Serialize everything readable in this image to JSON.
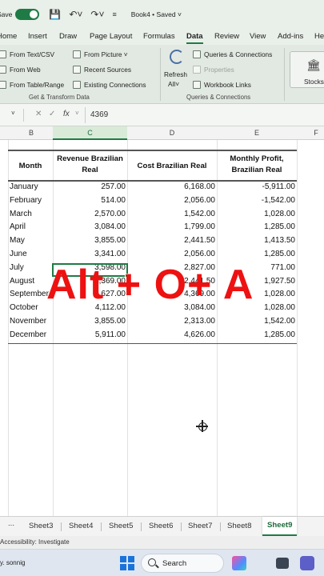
{
  "titlebar": {
    "save_label": "Save",
    "doc_title": "Book4 • Saved"
  },
  "tabs": [
    "Home",
    "Insert",
    "Draw",
    "Page Layout",
    "Formulas",
    "Data",
    "Review",
    "View",
    "Add-ins",
    "He"
  ],
  "active_tab": "Data",
  "ribbon": {
    "from_text_csv": "From Text/CSV",
    "from_web": "From Web",
    "from_table_range": "From Table/Range",
    "from_picture": "From Picture",
    "recent_sources": "Recent Sources",
    "existing_connections": "Existing Connections",
    "group_get_transform": "Get & Transform Data",
    "refresh_all_1": "Refresh",
    "refresh_all_2": "All",
    "queries_connections": "Queries & Connections",
    "properties": "Properties",
    "workbook_links": "Workbook Links",
    "group_queries": "Queries & Connections",
    "stocks": "Stocks"
  },
  "formula_bar": {
    "value": "4369"
  },
  "columns": [
    "B",
    "C",
    "D",
    "E",
    "F"
  ],
  "selected_column": "C",
  "table": {
    "headers": {
      "month": "Month",
      "revenue_1": "Revenue Brazilian",
      "revenue_2": "Real",
      "cost": "Cost Brazilian Real",
      "profit_1": "Monthly Profit,",
      "profit_2": "Brazilian Real"
    },
    "rows": [
      {
        "month": "January",
        "revenue": "257.00",
        "cost": "6,168.00",
        "profit": "-5,911.00"
      },
      {
        "month": "February",
        "revenue": "514.00",
        "cost": "2,056.00",
        "profit": "-1,542.00"
      },
      {
        "month": "March",
        "revenue": "2,570.00",
        "cost": "1,542.00",
        "profit": "1,028.00"
      },
      {
        "month": "April",
        "revenue": "3,084.00",
        "cost": "1,799.00",
        "profit": "1,285.00"
      },
      {
        "month": "May",
        "revenue": "3,855.00",
        "cost": "2,441.50",
        "profit": "1,413.50"
      },
      {
        "month": "June",
        "revenue": "3,341.00",
        "cost": "2,056.00",
        "profit": "1,285.00"
      },
      {
        "month": "July",
        "revenue": "3,598.00",
        "cost": "2,827.00",
        "profit": "771.00"
      },
      {
        "month": "August",
        "revenue": "4,369.00",
        "cost": "2,441.50",
        "profit": "1,927.50"
      },
      {
        "month": "September",
        "revenue": "4,627.00",
        "cost": "4,369.00",
        "profit": "1,028.00"
      },
      {
        "month": "October",
        "revenue": "4,112.00",
        "cost": "3,084.00",
        "profit": "1,028.00"
      },
      {
        "month": "November",
        "revenue": "3,855.00",
        "cost": "2,313.00",
        "profit": "1,542.00"
      },
      {
        "month": "December",
        "revenue": "5,911.00",
        "cost": "4,626.00",
        "profit": "1,285.00"
      }
    ]
  },
  "overlay_text": "Alt + O+ A",
  "sheets": [
    "Sheet3",
    "Sheet4",
    "Sheet5",
    "Sheet6",
    "Sheet7",
    "Sheet8",
    "Sheet9"
  ],
  "active_sheet": "Sheet9",
  "more_sheets": "...",
  "status": {
    "accessibility": "Accessibility: Investigate"
  },
  "taskbar": {
    "weather": "y. sonnig",
    "search_label": "Search"
  },
  "colors": {
    "excel_green": "#1e7b45",
    "overlay_red": "#ee1111"
  }
}
